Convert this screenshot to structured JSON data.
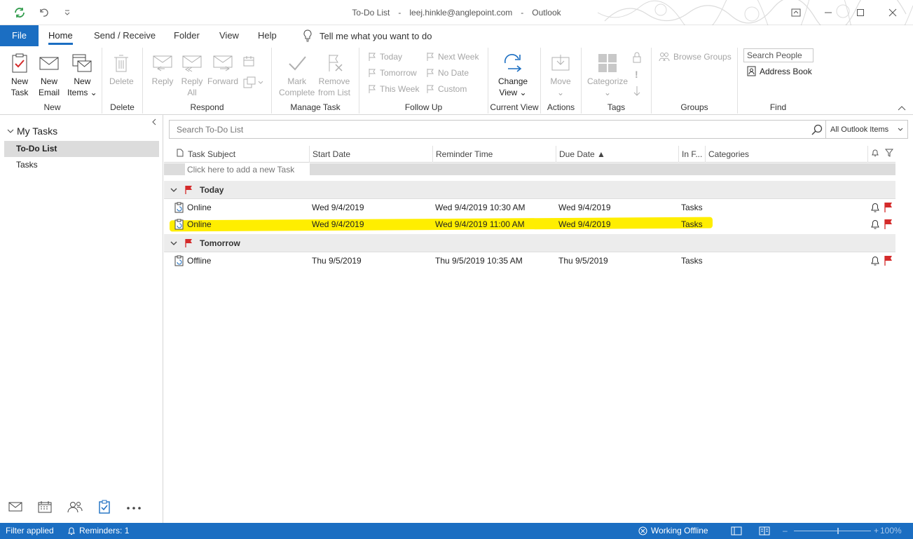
{
  "window": {
    "title_view": "To-Do List",
    "title_sep1": "-",
    "title_account": "leej.hinkle@anglepoint.com",
    "title_sep2": "-",
    "title_app": "Outlook"
  },
  "tabs": [
    "File",
    "Home",
    "Send / Receive",
    "Folder",
    "View",
    "Help"
  ],
  "active_tab": "Home",
  "tell_me": "Tell me what you want to do",
  "ribbon": {
    "new": {
      "label": "New",
      "new_task": [
        "New",
        "Task"
      ],
      "new_email": [
        "New",
        "Email"
      ],
      "new_items": [
        "New",
        "Items ⌄"
      ]
    },
    "delete": {
      "label": "Delete",
      "delete_btn": "Delete"
    },
    "respond": {
      "label": "Respond",
      "reply": "Reply",
      "reply_all": [
        "Reply",
        "All"
      ],
      "forward": "Forward"
    },
    "manage_task": {
      "label": "Manage Task",
      "mark_complete": [
        "Mark",
        "Complete"
      ],
      "remove_from_list": [
        "Remove",
        "from List"
      ]
    },
    "follow_up": {
      "label": "Follow Up",
      "today": "Today",
      "tomorrow": "Tomorrow",
      "this_week": "This Week",
      "next_week": "Next Week",
      "no_date": "No Date",
      "custom": "Custom"
    },
    "current_view": {
      "label": "Current View",
      "change_view": [
        "Change",
        "View ⌄"
      ]
    },
    "actions": {
      "label": "Actions",
      "move": [
        "Move",
        "⌄"
      ]
    },
    "tags": {
      "label": "Tags",
      "categorize": [
        "Categorize",
        "⌄"
      ]
    },
    "groups": {
      "label": "Groups",
      "browse_groups": "Browse Groups"
    },
    "find": {
      "label": "Find",
      "search_people": "Search People",
      "address_book": "Address Book"
    }
  },
  "nav": {
    "folder": "My Tasks",
    "items": [
      {
        "label": "To-Do List",
        "selected": true
      },
      {
        "label": "Tasks",
        "selected": false
      }
    ]
  },
  "search": {
    "placeholder": "Search To-Do List",
    "scope": "All Outlook Items"
  },
  "columns": [
    "Task Subject",
    "Start Date",
    "Reminder Time",
    "Due Date ▲",
    "In F...",
    "Categories"
  ],
  "add_task_prompt": "Click here to add a new Task",
  "groups": [
    {
      "label": "Today",
      "tasks": [
        {
          "subject": "Online",
          "start": "Wed 9/4/2019",
          "reminder": "Wed 9/4/2019 10:30 AM",
          "due": "Wed 9/4/2019",
          "folder": "Tasks",
          "highlighted": false
        },
        {
          "subject": "Online",
          "start": "Wed 9/4/2019",
          "reminder": "Wed 9/4/2019 11:00 AM",
          "due": "Wed 9/4/2019",
          "folder": "Tasks",
          "highlighted": true
        }
      ]
    },
    {
      "label": "Tomorrow",
      "tasks": [
        {
          "subject": "Offline",
          "start": "Thu 9/5/2019",
          "reminder": "Thu 9/5/2019 10:35 AM",
          "due": "Thu 9/5/2019",
          "folder": "Tasks",
          "highlighted": false
        }
      ]
    }
  ],
  "status": {
    "filter": "Filter applied",
    "reminders": "Reminders: 1",
    "offline": "Working Offline",
    "zoom": "100%"
  },
  "colors": {
    "accent": "#1b6ec2",
    "flag": "#d42a2a",
    "highlight": "#ffee00"
  }
}
